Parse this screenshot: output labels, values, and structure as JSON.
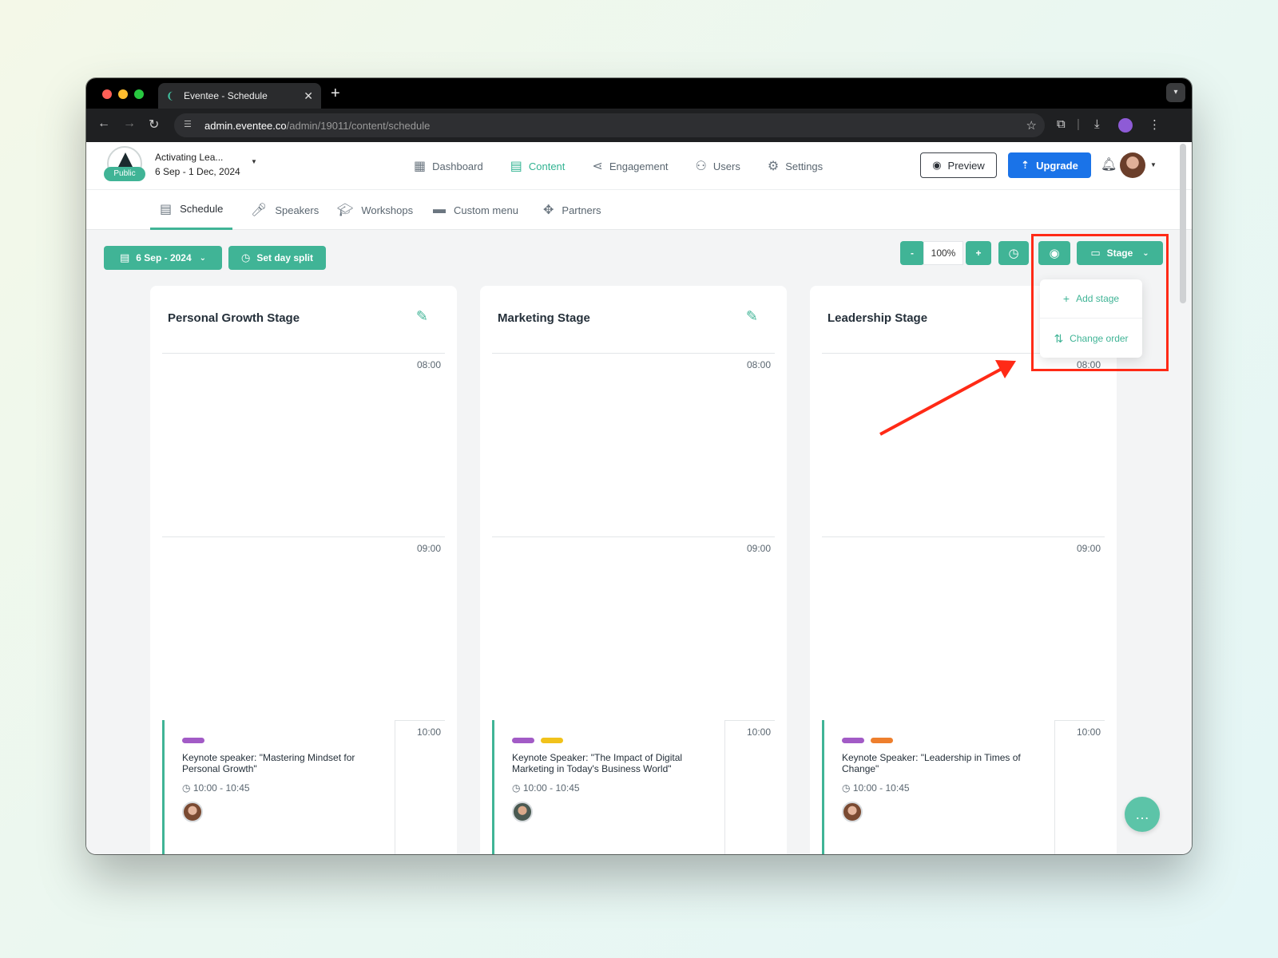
{
  "browser": {
    "tab_title": "Eventee - Schedule",
    "url_host": "admin.eventee.co",
    "url_path": "/admin/19011/content/schedule"
  },
  "event": {
    "badge": "Public",
    "name": "Activating Lea...",
    "dates": "6 Sep - 1 Dec, 2024"
  },
  "main_nav": [
    {
      "label": "Dashboard",
      "icon": "dashboard-icon"
    },
    {
      "label": "Content",
      "icon": "calendar-icon"
    },
    {
      "label": "Engagement",
      "icon": "share-icon"
    },
    {
      "label": "Users",
      "icon": "users-icon"
    },
    {
      "label": "Settings",
      "icon": "gear-icon"
    }
  ],
  "header_actions": {
    "preview": "Preview",
    "upgrade": "Upgrade"
  },
  "sub_nav": [
    {
      "label": "Schedule"
    },
    {
      "label": "Speakers"
    },
    {
      "label": "Workshops"
    },
    {
      "label": "Custom menu"
    },
    {
      "label": "Partners"
    }
  ],
  "toolbar": {
    "date_select": "6 Sep - 2024",
    "day_split": "Set day split",
    "zoom_minus": "-",
    "zoom_value": "100%",
    "zoom_plus": "+",
    "stage_button": "Stage"
  },
  "stage_menu": {
    "add": "Add stage",
    "order": "Change order"
  },
  "stages": [
    {
      "name": "Personal Growth Stage",
      "times": [
        "08:00",
        "09:00",
        "10:00"
      ],
      "session": {
        "title": "Keynote speaker: \"Mastering Mindset for Personal Growth\"",
        "time": "10:00 - 10:45",
        "tags": [
          "#a25bc6"
        ]
      }
    },
    {
      "name": "Marketing Stage",
      "times": [
        "08:00",
        "09:00",
        "10:00"
      ],
      "session": {
        "title": "Keynote Speaker: \"The Impact of Digital Marketing in Today's Business World\"",
        "time": "10:00 - 10:45",
        "tags": [
          "#a25bc6",
          "#f1c21b"
        ]
      }
    },
    {
      "name": "Leadership Stage",
      "times": [
        "08:00",
        "09:00",
        "10:00"
      ],
      "session": {
        "title": "Keynote Speaker: \"Leadership in Times of Change\"",
        "time": "10:00 - 10:45",
        "tags": [
          "#a25bc6",
          "#ee7f2d"
        ]
      }
    }
  ],
  "colors": {
    "accent": "#40b496",
    "annotation": "#ff2a16",
    "upgrade": "#1a73e8"
  }
}
